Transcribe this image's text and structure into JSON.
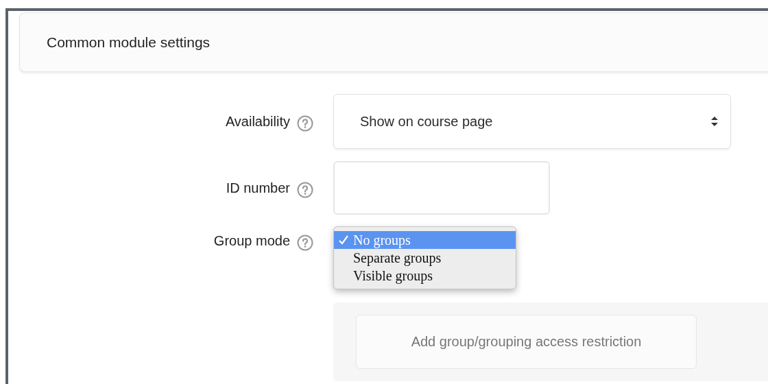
{
  "section": {
    "title": "Common module settings"
  },
  "fields": [
    {
      "kind": "select",
      "label": "Availability",
      "value": "Show on course page"
    },
    {
      "kind": "text",
      "label": "ID number"
    },
    {
      "kind": "dropdown",
      "label": "Group mode",
      "options": [
        {
          "label": "No groups",
          "selected": true
        },
        {
          "label": "Separate groups",
          "selected": false
        },
        {
          "label": "Visible groups",
          "selected": false
        }
      ]
    }
  ],
  "restriction": {
    "button": "Add group/grouping access restriction"
  }
}
